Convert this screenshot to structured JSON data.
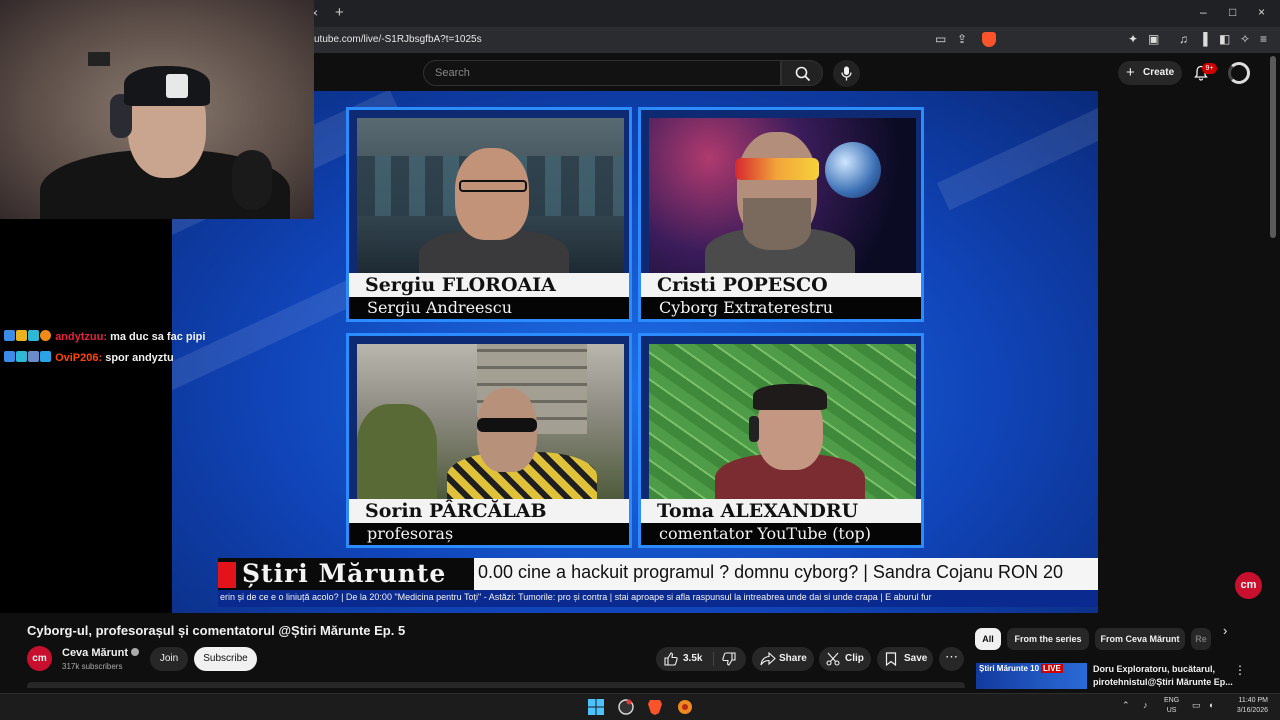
{
  "browser": {
    "url": "utube.com/live/-S1RJbsgfbA?t=1025s",
    "tab_close": "×",
    "tab_new": "+",
    "window_controls": [
      "–",
      "□",
      "×"
    ]
  },
  "youtube_header": {
    "search_placeholder": "Search",
    "create_label": "Create",
    "notifications_badge": "9+"
  },
  "chat": [
    {
      "user": "andytzuu:",
      "message": "ma duc sa fac pipi"
    },
    {
      "user": "OviP206:",
      "message": "spor andyztu"
    }
  ],
  "video": {
    "panels": [
      {
        "name": "Sergiu FLOROAIA",
        "role": "Sergiu Andreescu"
      },
      {
        "name": "Cristi POPESCO",
        "role": "Cyborg Extraterestru"
      },
      {
        "name": "Sorin PÂRCĂLAB",
        "role": "profesoraș"
      },
      {
        "name": "Toma ALEXANDRU",
        "role": "comentator YouTube (top)"
      }
    ],
    "ticker_brand": "Știri Mărunte",
    "ticker_text": "0.00 cine a hackuit programul ? domnu cyborg? |  Sandra Cojanu RON 20",
    "ticker_sub": "erin și de ce e o liniuță acolo? |  De la 20:00 \"Medicina pentru Toți\"  - Astăzi: Tumorile: pro și contra |  stai aproape si afla raspunsul la intreabrea unde dai si unde crapa  |  E aburul fur",
    "corner_logo": "cm"
  },
  "video_info": {
    "title": "Cyborg-ul, profesorașul și comentatorul @Știri Mărunte Ep. 5",
    "channel_name": "Ceva Mărunt",
    "channel_avatar": "cm",
    "subscribers": "317k subscribers",
    "join_label": "Join",
    "subscribe_label": "Subscribe",
    "likes": "3.5k",
    "share_label": "Share",
    "clip_label": "Clip",
    "save_label": "Save",
    "more_label": "⋯"
  },
  "sidebar": {
    "chips": [
      "All",
      "From the series",
      "From Ceva Mărunt",
      "Re"
    ],
    "recommendation": {
      "thumb_text": "Știri Mărunte 10",
      "thumb_live": "LIVE",
      "title": "Doru Exploratoru, bucătarul, pirotehnistul@Știri Mărunte Ep..."
    }
  },
  "taskbar": {
    "lang_top": "ENG",
    "lang_bottom": "US",
    "time": "11:40 PM",
    "date": "3/16/2026"
  },
  "colors": {
    "youtube_red": "#cc0000",
    "channel_red": "#c8102e",
    "studio_blue": "#1e6fe8",
    "brave_orange": "#fb542b"
  }
}
